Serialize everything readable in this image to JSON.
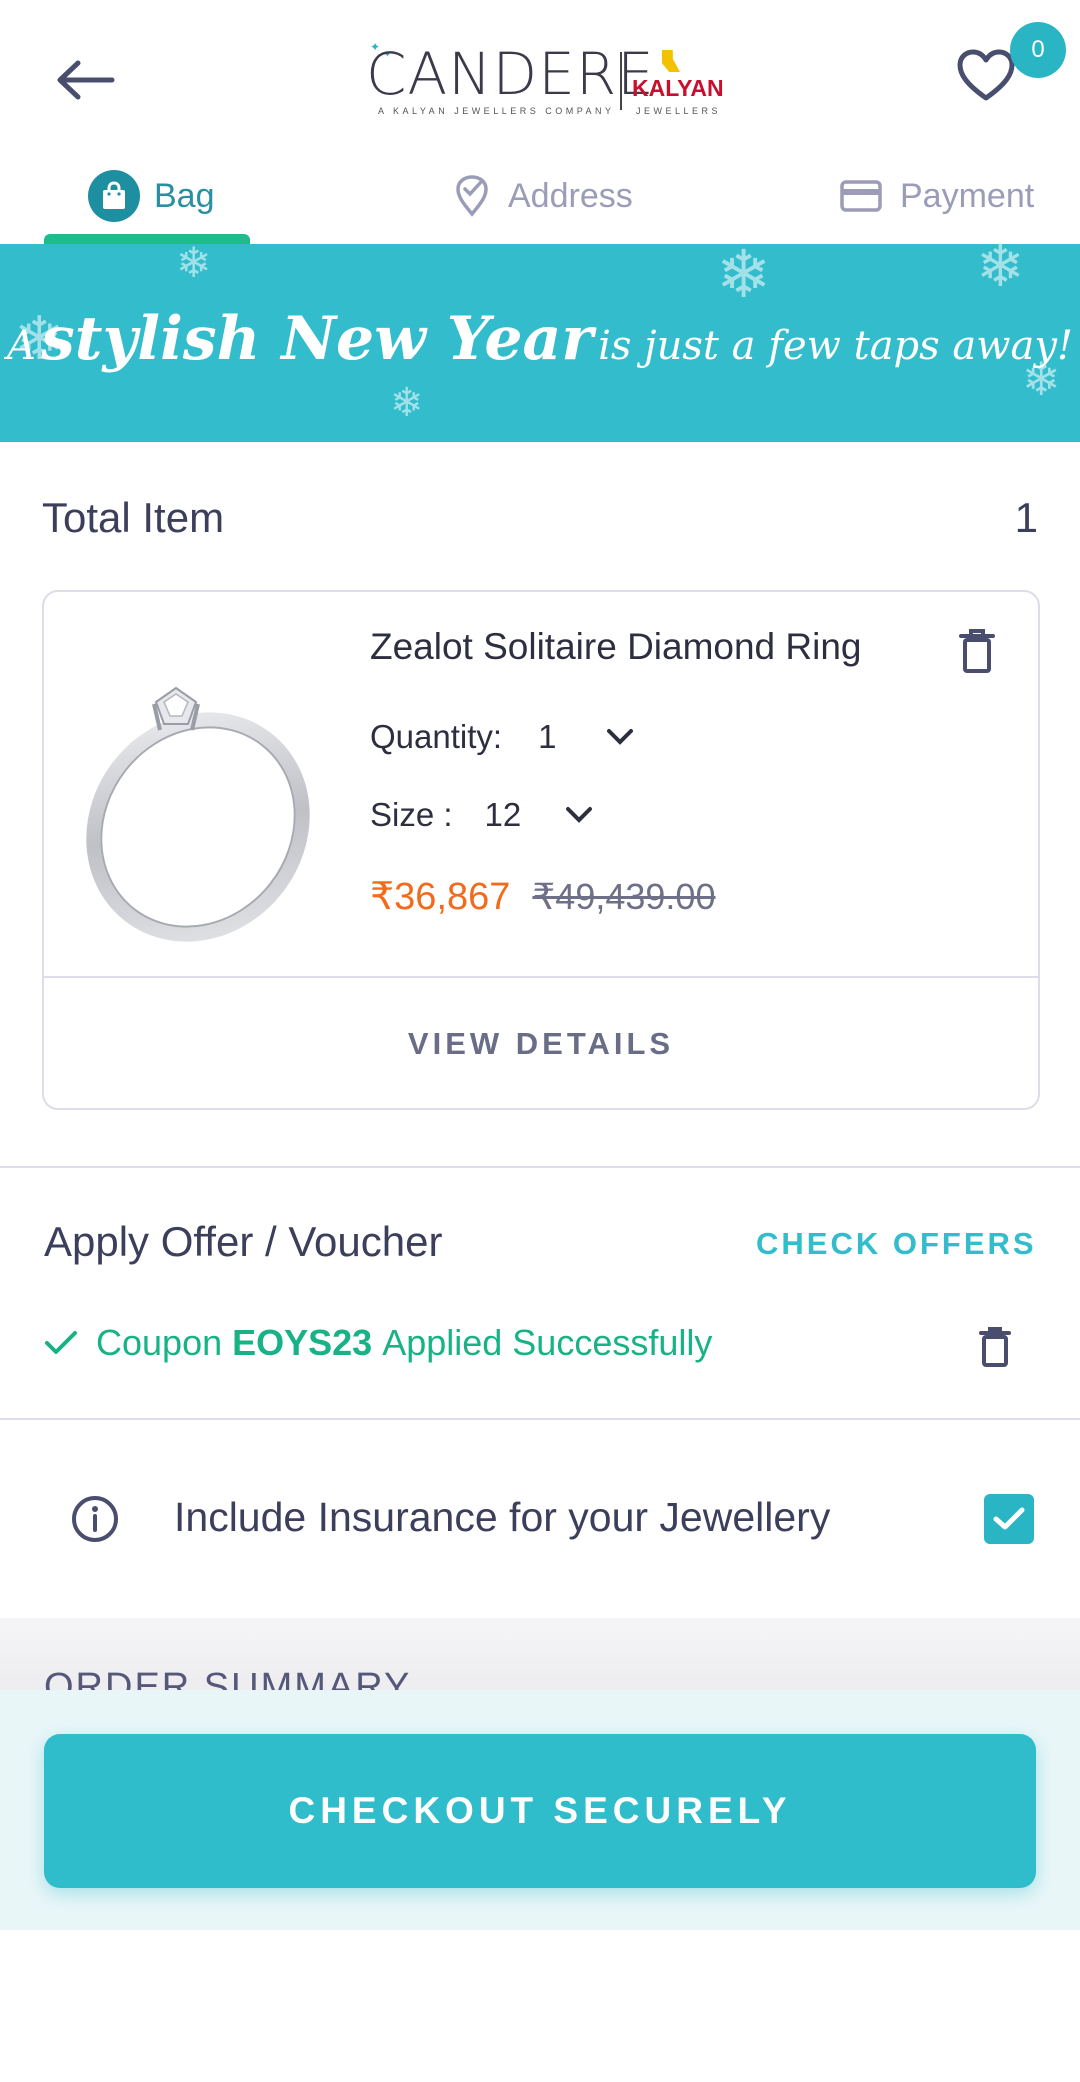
{
  "header": {
    "brand": "CANDERE",
    "brand_tagline": "A KALYAN JEWELLERS COMPANY",
    "partner": "KALYAN",
    "partner_sub": "JEWELLERS",
    "wishlist_count": "0"
  },
  "steps": {
    "bag": "Bag",
    "address": "Address",
    "payment": "Payment"
  },
  "banner": {
    "lead": "A",
    "highlight": "stylish New Year",
    "tail": "is just a few taps away!"
  },
  "total": {
    "label": "Total Item",
    "count": "1"
  },
  "product": {
    "name": "Zealot Solitaire Diamond Ring",
    "quantity_label": "Quantity:",
    "quantity_value": "1",
    "size_label": "Size :",
    "size_value": "12",
    "price": "₹36,867",
    "original_price": "₹49,439.00",
    "view_details": "VIEW DETAILS"
  },
  "offer": {
    "title": "Apply Offer / Voucher",
    "check_offers": "CHECK OFFERS",
    "coupon_prefix": "Coupon",
    "coupon_code": "EOYS23",
    "coupon_suffix": "Applied Successfully"
  },
  "insurance": {
    "label": "Include Insurance for your Jewellery",
    "checked": true
  },
  "summary": {
    "title": "ORDER SUMMARY"
  },
  "checkout": {
    "label": "CHECKOUT SECURELY"
  },
  "colors": {
    "accent": "#2fbccb",
    "success": "#17b386",
    "price": "#f26b1d"
  }
}
